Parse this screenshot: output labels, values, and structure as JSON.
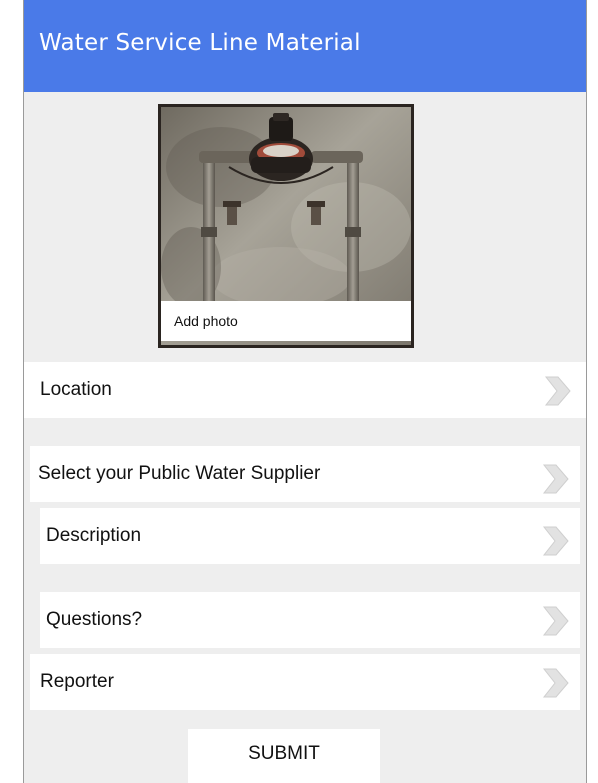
{
  "header": {
    "title": "Water Service Line Material",
    "color": "#4a7ae8"
  },
  "photo": {
    "caption": "Add photo",
    "subject": "water meter with pipes and valves"
  },
  "rows": [
    {
      "label": "Location",
      "icon": "chevron-right-icon"
    },
    {
      "label": "Select your Public Water Supplier",
      "icon": "chevron-right-icon"
    },
    {
      "label": "Description",
      "icon": "chevron-right-icon"
    },
    {
      "label": "Questions?",
      "icon": "chevron-right-icon"
    },
    {
      "label": "Reporter",
      "icon": "chevron-right-icon"
    }
  ],
  "submit": {
    "label": "SUBMIT"
  }
}
